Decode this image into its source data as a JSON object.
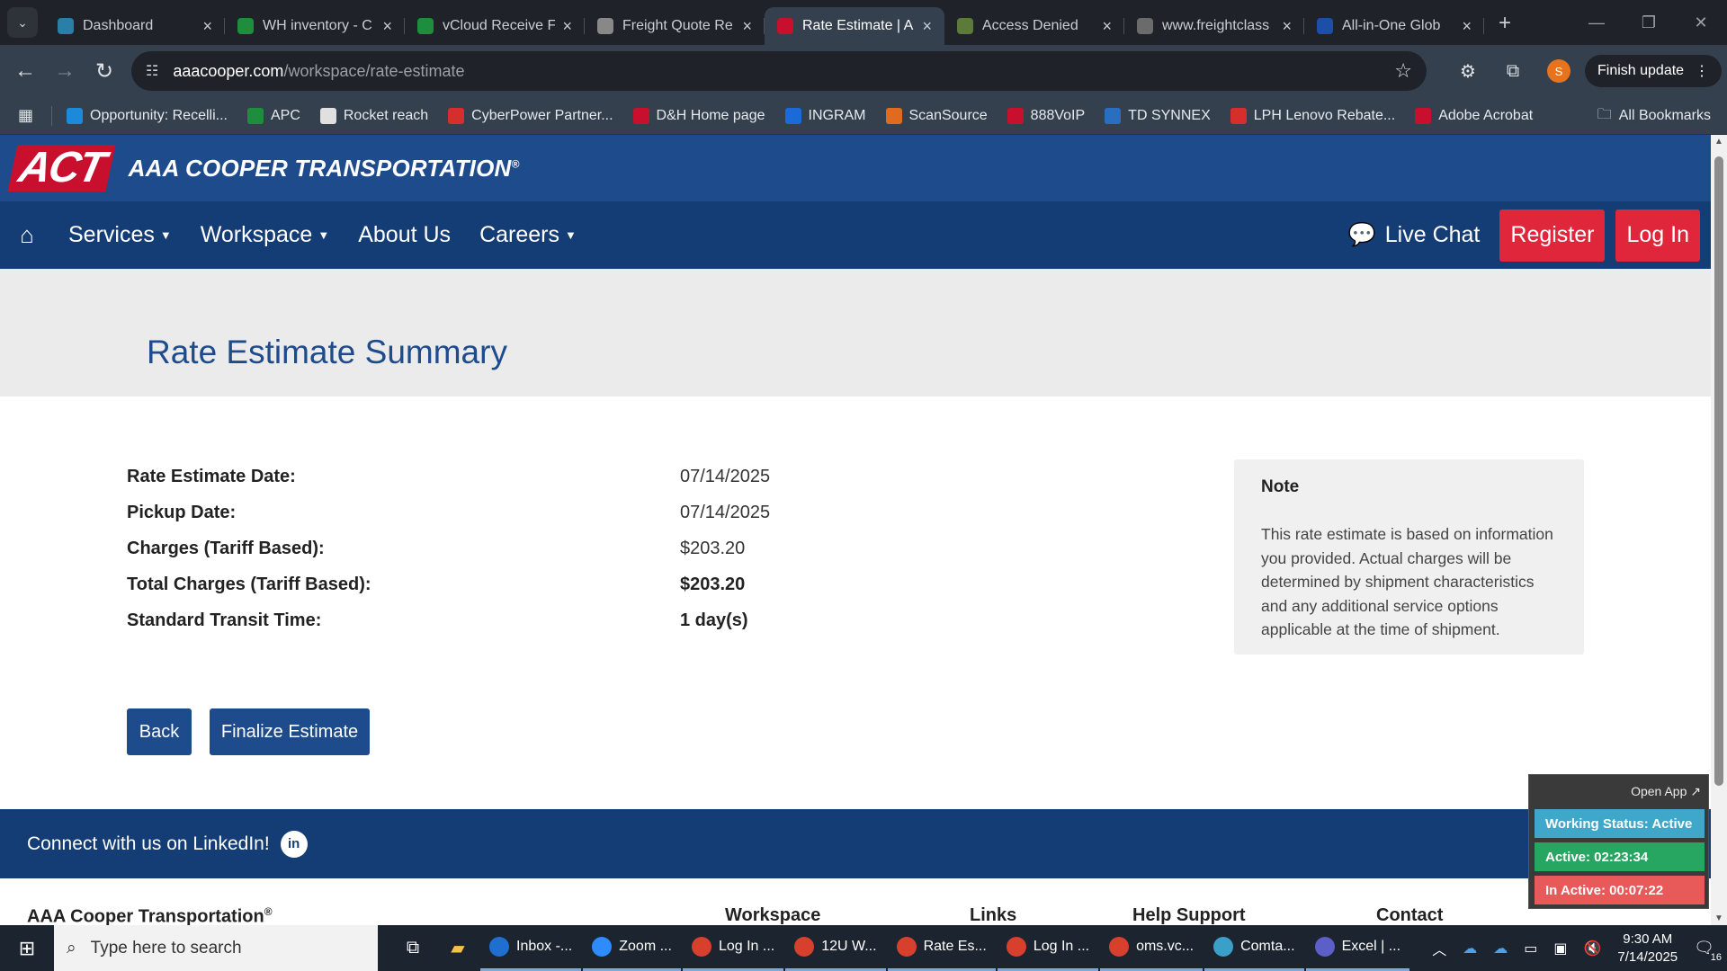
{
  "browser": {
    "tabs": [
      {
        "title": "Dashboard",
        "icon": "dashboard-favicon",
        "color": "#2a7fa8",
        "active": false
      },
      {
        "title": "WH inventory - C",
        "icon": "sheets-favicon",
        "color": "#1e8e3e",
        "active": false
      },
      {
        "title": "vCloud Receive F",
        "icon": "sheets-favicon",
        "color": "#1e8e3e",
        "active": false
      },
      {
        "title": "Freight Quote Re",
        "icon": "globe-favicon",
        "color": "#888888",
        "active": false
      },
      {
        "title": "Rate Estimate | A",
        "icon": "aaa-cooper-favicon",
        "color": "#c8102e",
        "active": true
      },
      {
        "title": "Access Denied",
        "icon": "globe-favicon",
        "color": "#5c7a3a",
        "active": false
      },
      {
        "title": "www.freightclass",
        "icon": "fcc-favicon",
        "color": "#6b6b6b",
        "active": false
      },
      {
        "title": "All-in-One Glob",
        "icon": "seventeen-track-favicon",
        "color": "#1e4fa8",
        "active": false
      }
    ],
    "url_host": "aaacooper.com",
    "url_path": "/workspace/rate-estimate",
    "finish_update": "Finish update",
    "profile_initial": "S",
    "bookmarks": [
      {
        "label": "Opportunity: Recelli...",
        "color": "#1c8ad8"
      },
      {
        "label": "APC",
        "color": "#1e8e3e"
      },
      {
        "label": "Rocket reach",
        "color": "#e0e0e0"
      },
      {
        "label": "CyberPower Partner...",
        "color": "#d62d2d"
      },
      {
        "label": "D&H Home page",
        "color": "#c8102e"
      },
      {
        "label": "INGRAM",
        "color": "#1c6ad8"
      },
      {
        "label": "ScanSource",
        "color": "#e06a1e"
      },
      {
        "label": "888VoIP",
        "color": "#c8102e"
      },
      {
        "label": "TD SYNNEX",
        "color": "#2a6fbf"
      },
      {
        "label": "LPH Lenovo Rebate...",
        "color": "#d62d2d"
      },
      {
        "label": "Adobe Acrobat",
        "color": "#c8102e"
      }
    ],
    "all_bookmarks": "All Bookmarks"
  },
  "site": {
    "logo_mark": "ACT",
    "brand": "AAA COOPER TRANSPORTATION",
    "brand_mark": "®",
    "nav": [
      {
        "label": "Services",
        "dropdown": true
      },
      {
        "label": "Workspace",
        "dropdown": true
      },
      {
        "label": "About Us",
        "dropdown": false
      },
      {
        "label": "Careers",
        "dropdown": true
      }
    ],
    "live_chat": "Live Chat",
    "register": "Register",
    "login": "Log In",
    "colors": {
      "header": "#1e4b8c",
      "nav": "#153d75",
      "accent_red": "#e0263a"
    }
  },
  "page": {
    "title": "Rate Estimate Summary",
    "summary": [
      {
        "label": "Rate Estimate Date:",
        "value": "07/14/2025",
        "bold": false
      },
      {
        "label": "Pickup Date:",
        "value": "07/14/2025",
        "bold": false
      },
      {
        "label": "Charges (Tariff Based):",
        "value": "$203.20",
        "bold": false
      },
      {
        "label": "Total Charges (Tariff Based):",
        "value": "$203.20",
        "bold": true
      },
      {
        "label": "Standard Transit Time:",
        "value": "1 day(s)",
        "bold": true
      }
    ],
    "note_title": "Note",
    "note_text": "This rate estimate is based on information you provided. Actual charges will be determined by shipment characteristics and any additional service options applicable at the time of shipment.",
    "back_button": "Back",
    "finalize_button": "Finalize Estimate"
  },
  "footer": {
    "linkedin_text": "Connect with us on LinkedIn!",
    "company": "AAA Cooper Transportation",
    "company_mark": "®",
    "columns": [
      "Workspace",
      "Links",
      "Help Support",
      "Contact"
    ]
  },
  "widget": {
    "open_app": "Open App ↗",
    "working_status": "Working Status: Active",
    "active": "Active: 02:23:34",
    "inactive": "In Active: 00:07:22",
    "colors": {
      "status": "#3fa7c9",
      "active": "#27a661",
      "inactive": "#e85a5a"
    }
  },
  "taskbar": {
    "search_placeholder": "Type here to search",
    "apps": [
      {
        "label": "Inbox -...",
        "icon": "outlook-icon",
        "color": "#1e6fd0"
      },
      {
        "label": "Zoom ...",
        "icon": "zoom-icon",
        "color": "#2d8cff"
      },
      {
        "label": "Log In ...",
        "icon": "chrome-icon",
        "color": "#d8402e"
      },
      {
        "label": "12U W...",
        "icon": "chrome-icon",
        "color": "#d8402e"
      },
      {
        "label": "Rate Es...",
        "icon": "chrome-icon",
        "color": "#d8402e"
      },
      {
        "label": "Log In ...",
        "icon": "chrome-icon",
        "color": "#d8402e"
      },
      {
        "label": "oms.vc...",
        "icon": "chrome-icon",
        "color": "#d8402e"
      },
      {
        "label": "Comta...",
        "icon": "app-icon",
        "color": "#3aa0c8"
      },
      {
        "label": "Excel | ...",
        "icon": "teams-icon",
        "color": "#5b5fc7"
      }
    ],
    "time": "9:30 AM",
    "date": "7/14/2025",
    "notifications": "16"
  }
}
